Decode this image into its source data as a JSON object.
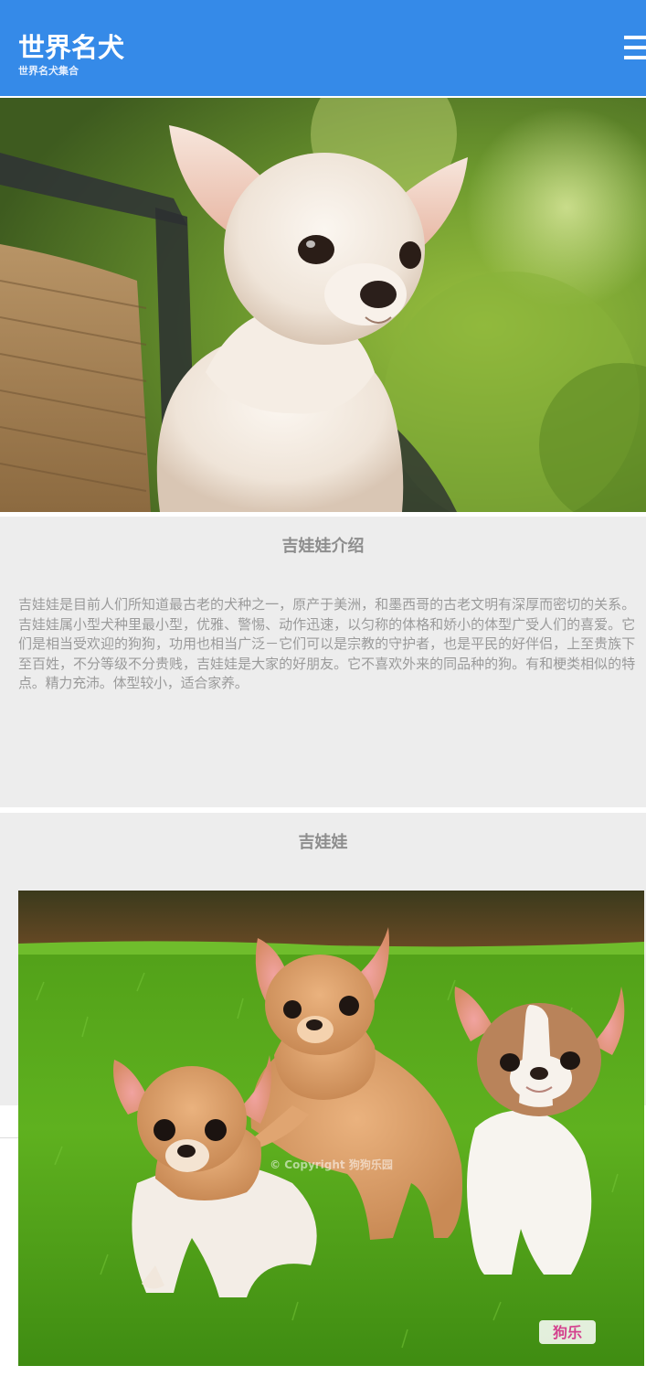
{
  "header": {
    "title": "世界名犬",
    "subtitle": "世界名犬集合",
    "menu_icon": "hamburger-menu-icon",
    "background_color": "#358ae8"
  },
  "hero": {
    "image": "chihuahua-photo"
  },
  "intro": {
    "title": "吉娃娃介绍",
    "body": "吉娃娃是目前人们所知道最古老的犬种之一，原产于美洲，和墨西哥的古老文明有深厚而密切的关系。吉娃娃属小型犬种里最小型，优雅、警惕、动作迅速，以匀称的体格和娇小的体型广受人们的喜爱。它们是相当受欢迎的狗狗，功用也相当广泛－它们可以是宗教的守护者，也是平民的好伴侣，上至贵族下至百姓，不分等级不分贵贱，吉娃娃是大家的好朋友。它不喜欢外来的同品种的狗。有和梗类相似的特点。精力充沛。体型较小，适合家养。"
  },
  "gallery": {
    "title": "吉娃娃",
    "image": "chihuahua-puppies-photo",
    "watermark": "狗乐"
  },
  "footer": {
    "copyright": "© Copyright 狗狗乐园"
  }
}
